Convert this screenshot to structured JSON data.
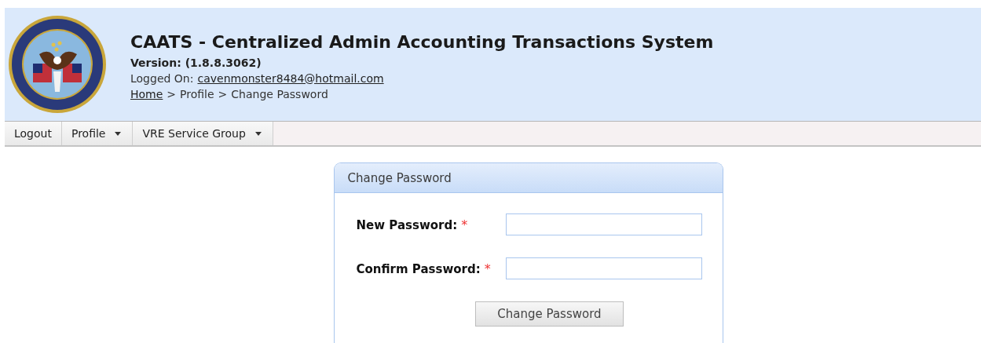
{
  "header": {
    "title": "CAATS - Centralized Admin Accounting Transactions System",
    "version": "Version: (1.8.8.3062)",
    "logged_on_label": "Logged On:",
    "logged_on_user": "cavenmonster8484@hotmail.com",
    "breadcrumb": [
      {
        "kind": "link",
        "label": "Home"
      },
      {
        "kind": "separator",
        "label": ">"
      },
      {
        "kind": "text",
        "label": "Profile"
      },
      {
        "kind": "separator",
        "label": ">"
      },
      {
        "kind": "text",
        "label": "Change Password"
      }
    ]
  },
  "menu": [
    {
      "label": "Logout",
      "dropdown": false
    },
    {
      "label": "Profile",
      "dropdown": true
    },
    {
      "label": "VRE Service Group",
      "dropdown": true
    }
  ],
  "panel": {
    "title": "Change Password",
    "fields": [
      {
        "label": "New Password:",
        "required_mark": "*"
      },
      {
        "label": "Confirm Password:",
        "required_mark": "*"
      }
    ],
    "button": "Change Password"
  }
}
